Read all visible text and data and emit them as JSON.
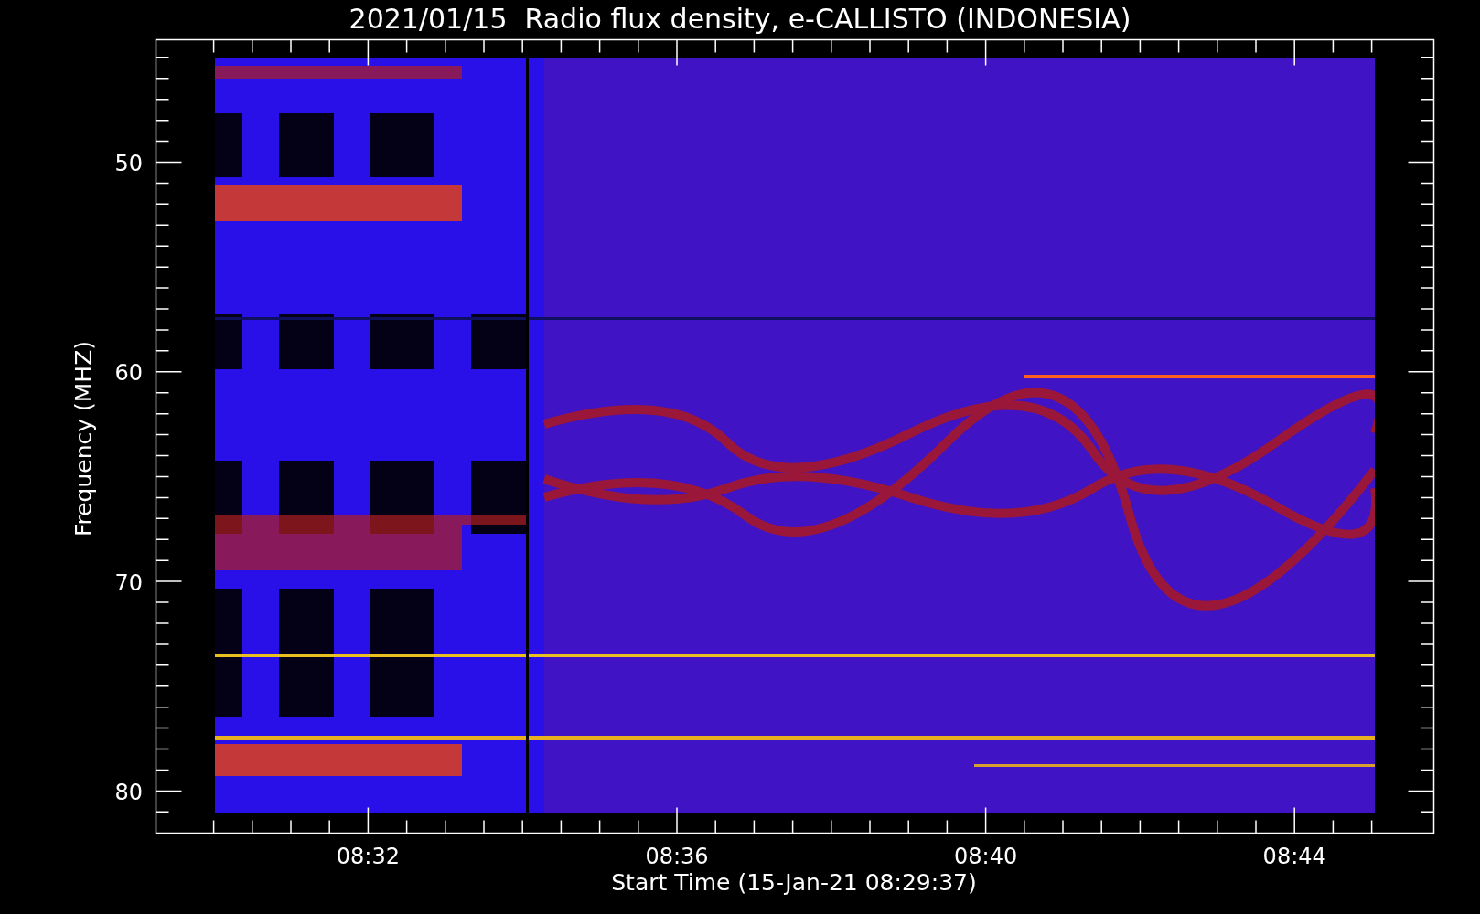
{
  "title": "2021/01/15  Radio flux density, e-CALLISTO (INDONESIA)",
  "y_axis": {
    "label": "Frequency (MHZ)",
    "ticks": [
      "50",
      "60",
      "70",
      "80"
    ]
  },
  "x_axis": {
    "label": "Start Time (15-Jan-21 08:29:37)",
    "ticks": [
      "08:32",
      "08:36",
      "08:40",
      "08:44"
    ]
  }
}
